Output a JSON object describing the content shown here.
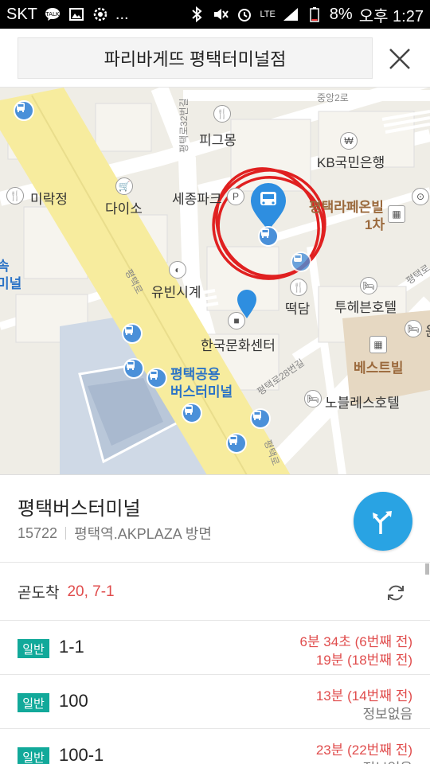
{
  "status_bar": {
    "carrier": "SKT",
    "more": "...",
    "network": "LTE",
    "battery": "8%",
    "time": "오후 1:27"
  },
  "search": {
    "query": "파리바게뜨 평택터미널점"
  },
  "map": {
    "labels": {
      "road_jungang": "중앙2로",
      "road_32": "평택로32번길",
      "road_pyeongtaek": "평택로",
      "road_28": "평택로28번길",
      "road_pyeongtaek2": "평택로",
      "road_right": "평택로",
      "pigomong": "피그몽",
      "kb_bank": "KB국민은행",
      "mirakjeong": "미락정",
      "daiso": "다이소",
      "sejong_park": "세종파크",
      "pyeongtaek_lapeon": "평택라페온빌",
      "lapeon_1": "1차",
      "express_partial": "속",
      "terminal_partial": "미널",
      "yubin_watch": "유빈시계",
      "tteokdam": "떡담",
      "two_hearts_hotel": "투헤븐호텔",
      "korea_culture": "한국문화센터",
      "best_bill": "베스트빌",
      "public_terminal_1": "평택공용",
      "public_terminal_2": "버스터미널",
      "noble_hotel": "노블레스호텔",
      "edge_partial": "윤"
    }
  },
  "stop": {
    "name": "평택버스터미널",
    "id": "15722",
    "direction": "평택역.AKPLAZA 방면"
  },
  "soon_arriving": {
    "label": "곧도착",
    "buses": "20, 7-1"
  },
  "buses": [
    {
      "type": "일반",
      "number": "1-1",
      "arrival1": "6분 34초 (6번째 전)",
      "arrival2": "19분 (18번째 전)",
      "arrival2_status": "red"
    },
    {
      "type": "일반",
      "number": "100",
      "arrival1": "13분 (14번째 전)",
      "arrival2": "정보없음",
      "arrival2_status": "gray"
    },
    {
      "type": "일반",
      "number": "100-1",
      "arrival1": "23분 (22번째 전)",
      "arrival2": "정보없음",
      "arrival2_status": "gray"
    }
  ],
  "colors": {
    "accent": "#29a3e3",
    "badge": "#12a99a",
    "arrival": "#e04c4c",
    "main_road": "#f7ec9e",
    "annotation": "#e02020"
  }
}
